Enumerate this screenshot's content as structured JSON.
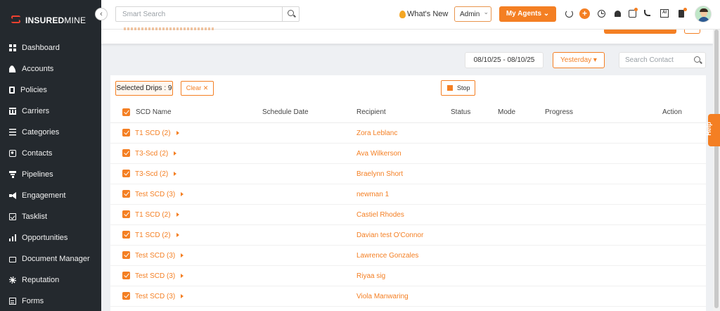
{
  "brand": {
    "logo_bold": "INSURED",
    "logo_light": "MINE"
  },
  "sidebar": {
    "collapse_icon": "‹",
    "items": [
      {
        "label": "Dashboard",
        "icon": "grid-icon"
      },
      {
        "label": "Accounts",
        "icon": "users-icon"
      },
      {
        "label": "Policies",
        "icon": "document-icon"
      },
      {
        "label": "Carriers",
        "icon": "bank-icon"
      },
      {
        "label": "Categories",
        "icon": "list-icon"
      },
      {
        "label": "Contacts",
        "icon": "contact-card-icon"
      },
      {
        "label": "Pipelines",
        "icon": "funnel-icon"
      },
      {
        "label": "Engagement",
        "icon": "megaphone-icon"
      },
      {
        "label": "Tasklist",
        "icon": "checkbox-icon"
      },
      {
        "label": "Opportunities",
        "icon": "bar-chart-icon"
      },
      {
        "label": "Document Manager",
        "icon": "folder-icon"
      },
      {
        "label": "Reputation",
        "icon": "badge-icon"
      },
      {
        "label": "Forms",
        "icon": "form-icon"
      }
    ]
  },
  "header": {
    "search_placeholder": "Smart Search",
    "whats_new": "What's New",
    "role": "Admin",
    "agents_button": "My Agents ⌄",
    "colors": {
      "accent": "#f47f23",
      "sidebar": "#24292e"
    }
  },
  "filters": {
    "date_range": "08/10/25 - 08/10/25",
    "period": "Yesterday ▾",
    "contact_search_placeholder": "Search Contact"
  },
  "toolbar": {
    "selected_drips": "Selected Drips : 9",
    "clear": "Clear ✕",
    "stop": "Stop"
  },
  "table": {
    "columns": [
      "SCD Name",
      "Schedule Date",
      "Recipient",
      "Status",
      "Mode",
      "Progress",
      "Action"
    ],
    "rows": [
      {
        "name": "T1 SCD (2)",
        "recipient": "Zora Leblanc"
      },
      {
        "name": "T3-Scd (2)",
        "recipient": "Ava Wilkerson"
      },
      {
        "name": "T3-Scd (2)",
        "recipient": "Braelynn Short"
      },
      {
        "name": "Test SCD (3)",
        "recipient": "newman 1"
      },
      {
        "name": "T1 SCD (2)",
        "recipient": "Castiel Rhodes"
      },
      {
        "name": "T1 SCD (2)",
        "recipient": "Davian test O'Connor"
      },
      {
        "name": "Test SCD (3)",
        "recipient": "Lawrence Gonzales"
      },
      {
        "name": "Test SCD (3)",
        "recipient": "Riyaa sig"
      },
      {
        "name": "Test SCD (3)",
        "recipient": "Viola Manwaring"
      }
    ]
  },
  "help": {
    "label": "Help"
  }
}
